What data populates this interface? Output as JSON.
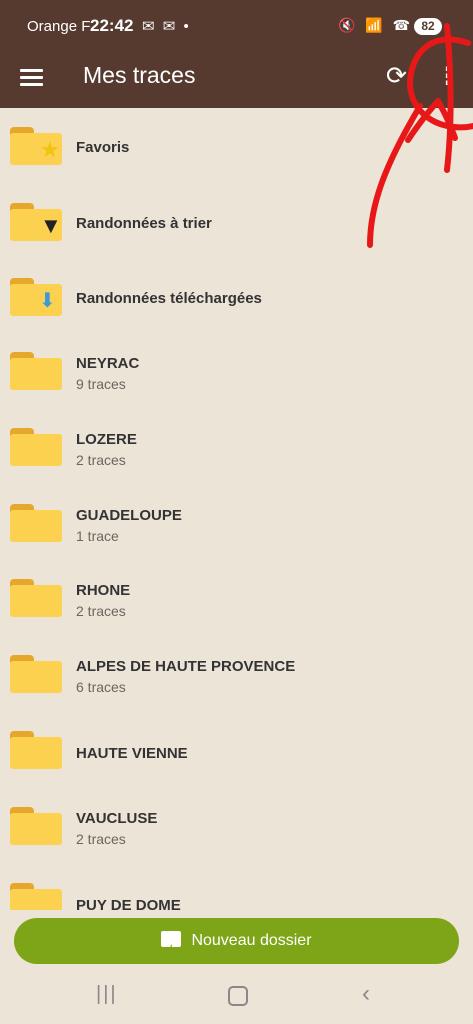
{
  "status": {
    "carrier": "Orange F",
    "time": "22:42",
    "battery": "82"
  },
  "toolbar": {
    "title": "Mes traces",
    "menu_icon": "hamburger-menu-icon",
    "sync_icon": "sync-icon",
    "more_icon": "more-vertical-icon"
  },
  "items": [
    {
      "label": "Favoris",
      "subtitle": "",
      "icon": "folder-star-icon"
    },
    {
      "label": "Randonnées à trier",
      "subtitle": "",
      "icon": "folder-filter-icon"
    },
    {
      "label": "Randonnées téléchargées",
      "subtitle": "",
      "icon": "folder-download-icon"
    },
    {
      "label": "NEYRAC",
      "subtitle": "9 traces",
      "icon": "folder-icon"
    },
    {
      "label": "LOZERE",
      "subtitle": "2 traces",
      "icon": "folder-icon"
    },
    {
      "label": "GUADELOUPE",
      "subtitle": "1 trace",
      "icon": "folder-icon"
    },
    {
      "label": "RHONE",
      "subtitle": "2 traces",
      "icon": "folder-icon"
    },
    {
      "label": "ALPES DE HAUTE PROVENCE",
      "subtitle": "6 traces",
      "icon": "folder-icon"
    },
    {
      "label": "HAUTE VIENNE",
      "subtitle": "",
      "icon": "folder-icon"
    },
    {
      "label": "VAUCLUSE",
      "subtitle": "2 traces",
      "icon": "folder-icon"
    },
    {
      "label": "PUY DE DOME",
      "subtitle": "",
      "icon": "folder-icon"
    }
  ],
  "fab": {
    "label": "Nouveau dossier",
    "icon": "create-folder-icon"
  },
  "colors": {
    "toolbar": "#563a2f",
    "background": "#ede4d8",
    "folder": "#fbd14f",
    "fab": "#7ea418",
    "annotation": "#e81818"
  }
}
